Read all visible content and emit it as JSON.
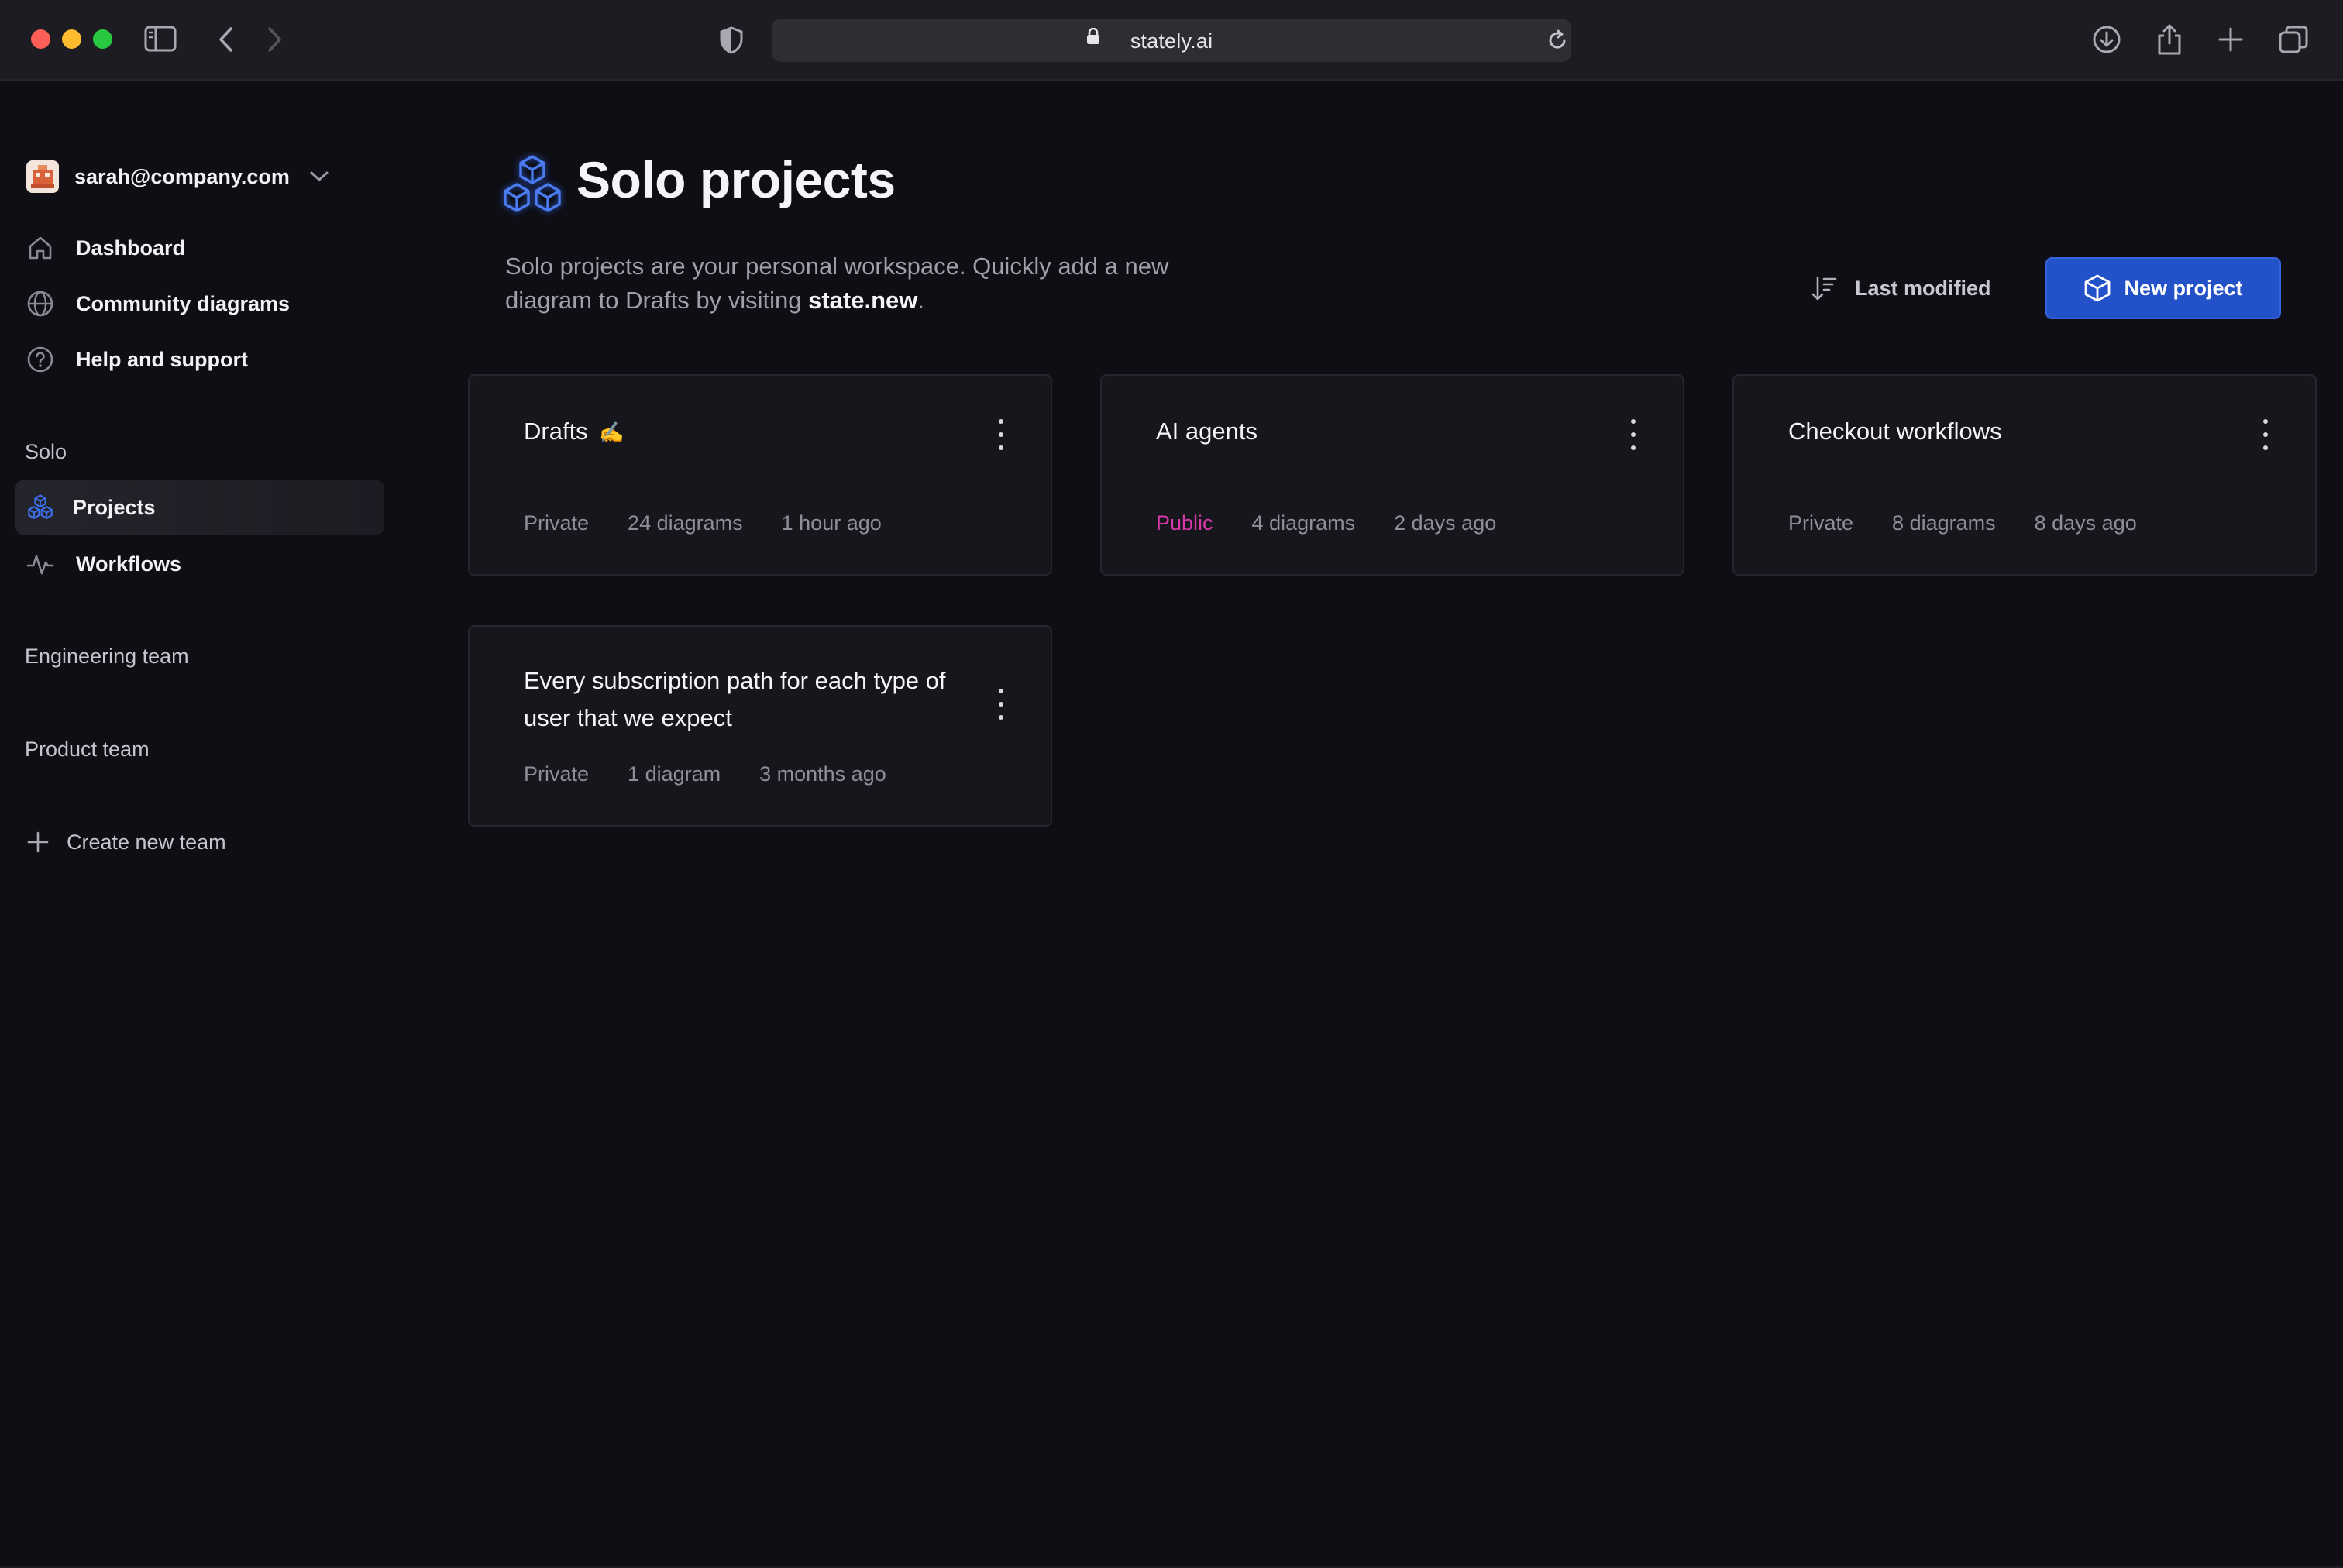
{
  "browser": {
    "url": "stately.ai"
  },
  "colors": {
    "accent": "#2351c8",
    "public_badge": "#d63aa8",
    "background": "#0e0e14"
  },
  "sidebar": {
    "account_email": "sarah@company.com",
    "nav": [
      {
        "label": "Dashboard",
        "icon": "home-icon"
      },
      {
        "label": "Community diagrams",
        "icon": "globe-icon"
      },
      {
        "label": "Help and support",
        "icon": "help-circle-icon"
      }
    ],
    "sections": [
      {
        "label": "Solo"
      },
      {
        "label": "Engineering team"
      },
      {
        "label": "Product team"
      }
    ],
    "solo_items": [
      {
        "label": "Projects",
        "icon": "cubes-icon",
        "active": true
      },
      {
        "label": "Workflows",
        "icon": "activity-icon",
        "active": false
      }
    ],
    "create_team_label": "Create new team"
  },
  "main": {
    "title": "Solo projects",
    "description_prefix": "Solo projects are your personal workspace. Quickly add a new diagram to Drafts by visiting ",
    "description_link": "state.new",
    "description_suffix": ".",
    "sort_label": "Last modified",
    "new_project_label": "New project",
    "projects": [
      {
        "title": "Drafts",
        "emoji": "✍️",
        "visibility": "Private",
        "count": "24 diagrams",
        "updated": "1 hour ago"
      },
      {
        "title": "AI agents",
        "emoji": "",
        "visibility": "Public",
        "count": "4 diagrams",
        "updated": "2 days ago"
      },
      {
        "title": "Checkout workflows",
        "emoji": "",
        "visibility": "Private",
        "count": "8 diagrams",
        "updated": "8 days ago"
      },
      {
        "title": "Every subscription path for each type of user that we expect",
        "emoji": "",
        "visibility": "Private",
        "count": "1 diagram",
        "updated": "3 months ago"
      }
    ]
  }
}
